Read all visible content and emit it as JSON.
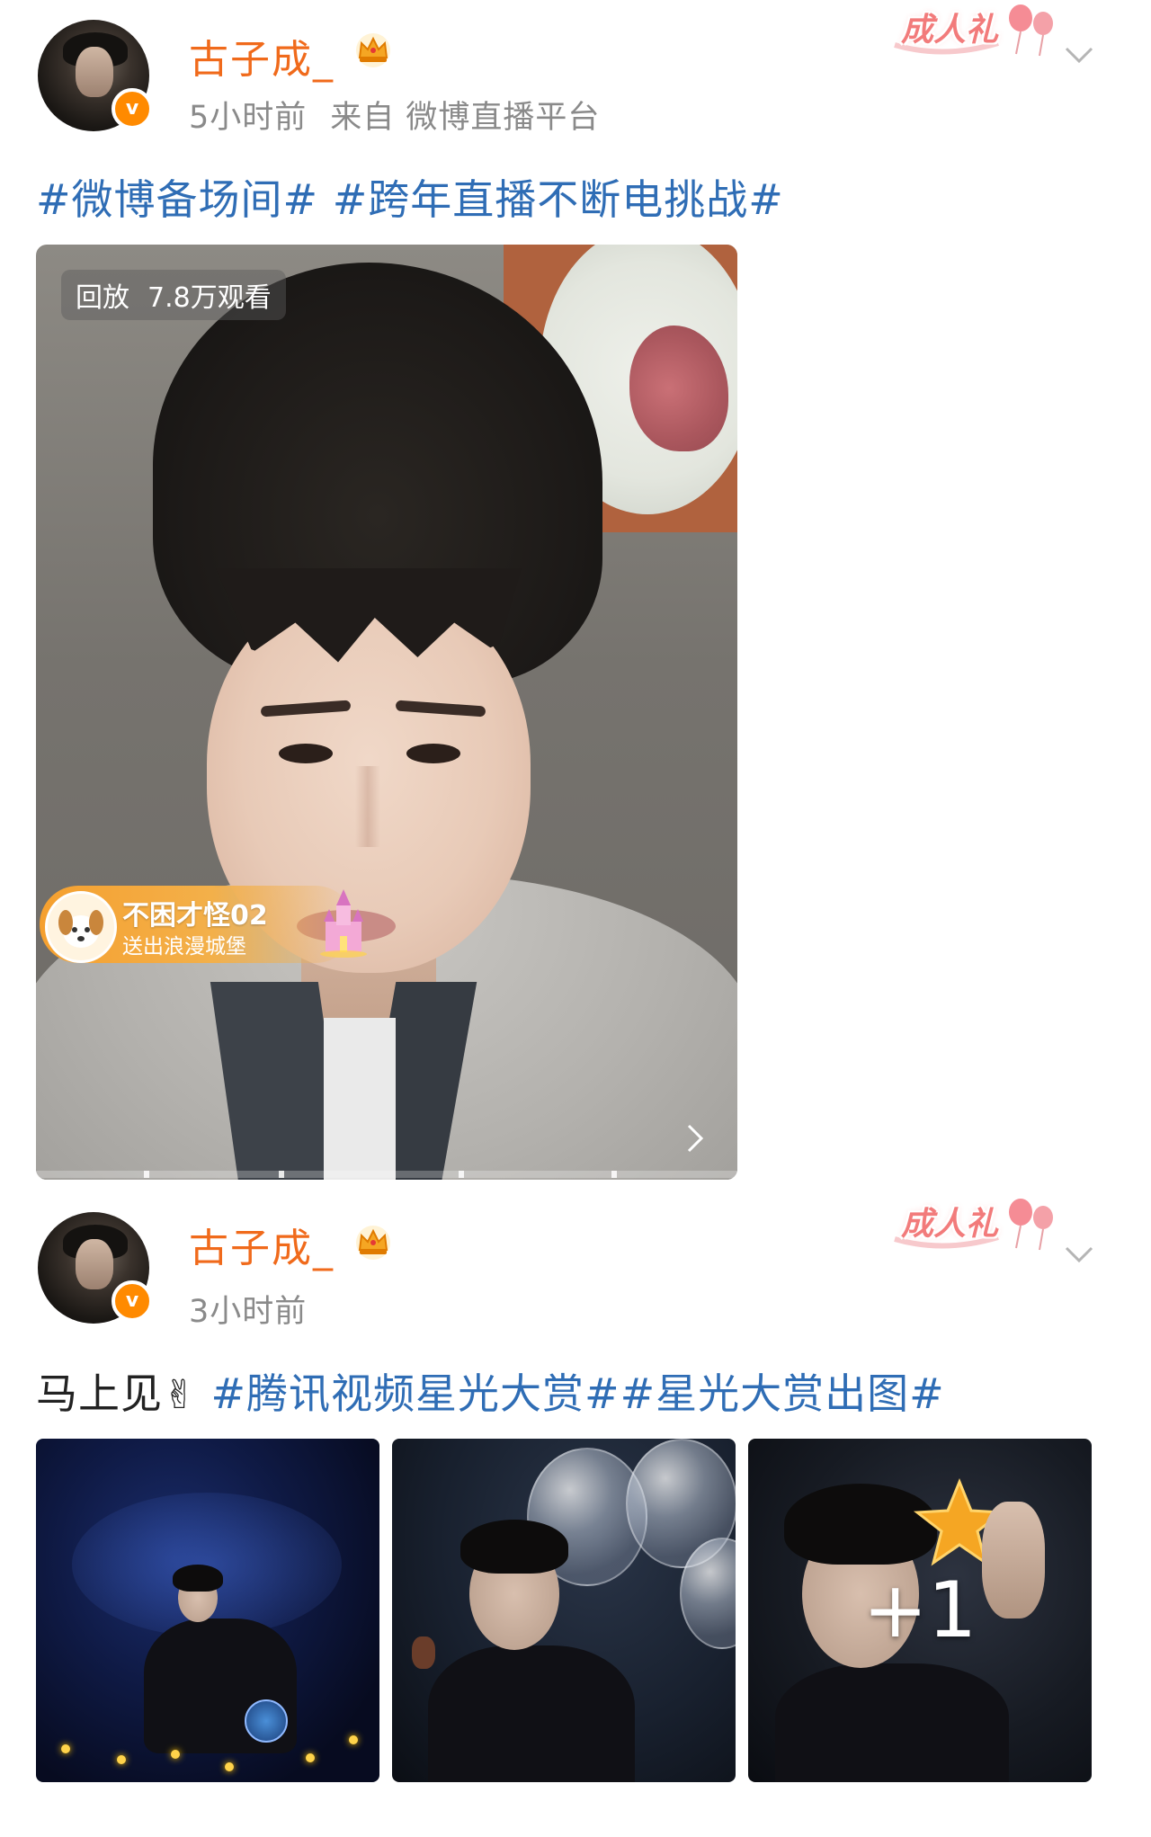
{
  "posts": [
    {
      "username": "古子成_",
      "time": "5小时前",
      "source": "来自 微博直播平台",
      "ribbon": "成人礼",
      "hashtags": [
        "#微博备场间#",
        "#跨年直播不断电挑战#"
      ],
      "video": {
        "replay_label": "回放",
        "views": "7.8万观看",
        "gift_sender": "不困才怪02",
        "gift_action": "送出浪漫城堡"
      }
    },
    {
      "username": "古子成_",
      "time": "3小时前",
      "ribbon": "成人礼",
      "text": "马上见",
      "emoji": "✌",
      "hashtags": [
        "#腾讯视频星光大赏#",
        "#星光大赏出图#"
      ],
      "more_count": "+1"
    }
  ],
  "colors": {
    "username": "#f06a1b",
    "hashtag": "#2f6db5",
    "meta": "#8a8a8a",
    "verified_badge": "#ff8a00"
  },
  "icons": {
    "verified": "v-badge-icon",
    "crown": "crown-icon",
    "more": "chevron-down-icon",
    "next": "chevron-right-icon"
  }
}
